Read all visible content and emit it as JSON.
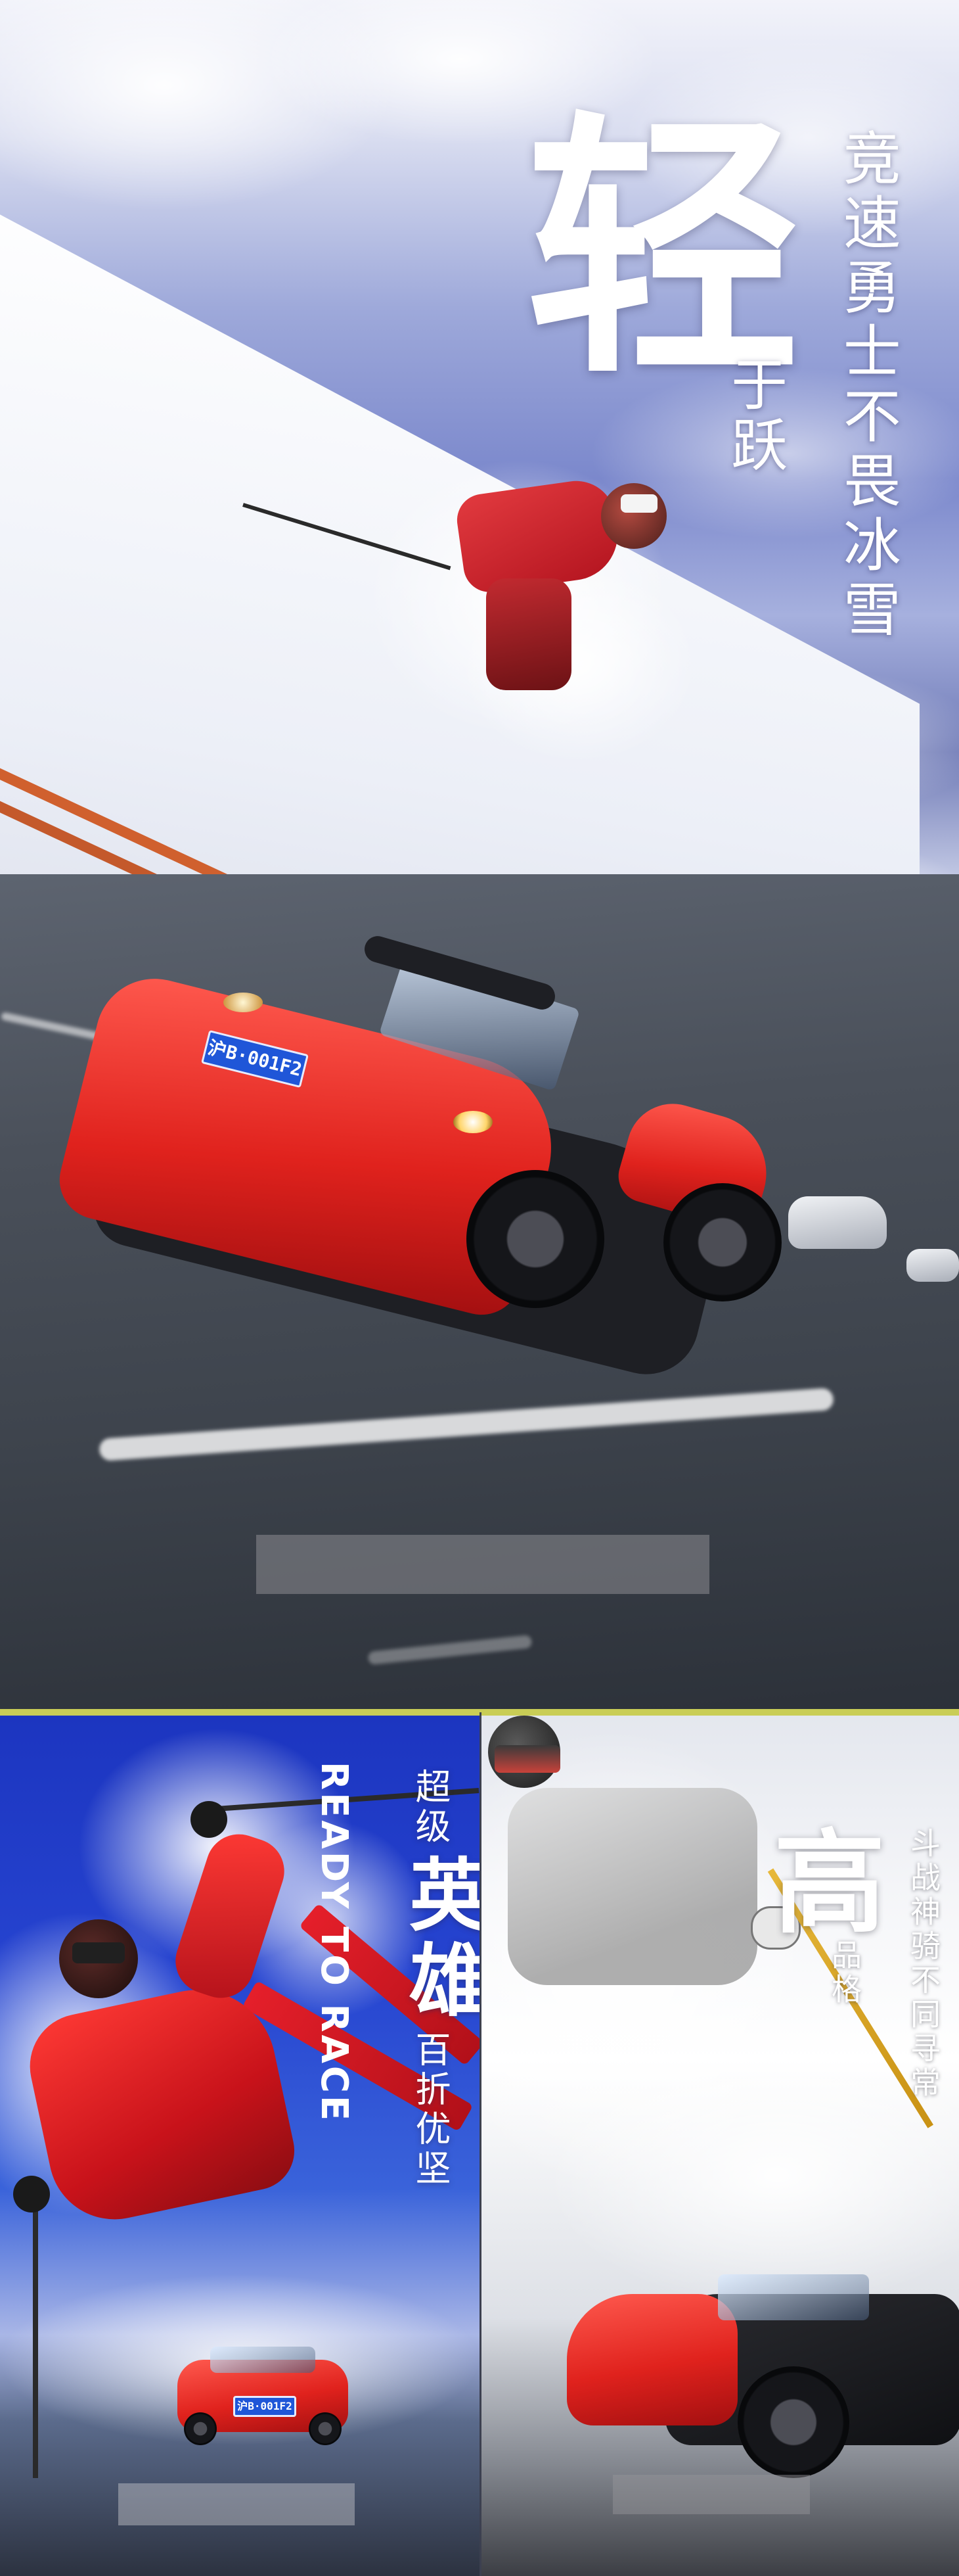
{
  "top_poster": {
    "big_char": "轻",
    "sub_char": "于跃",
    "tagline": "竞速勇士不畏冰雪",
    "plate": "沪B·001F2"
  },
  "left_poster": {
    "en_title": "READY TO RACE",
    "small_line": "超级",
    "big_char": "英雄",
    "tagline": "百折优坚",
    "plate": "沪B·001F2"
  },
  "right_poster": {
    "big_char": "高",
    "sub_char": "品格",
    "tagline": "斗战神骑不同寻常"
  },
  "colors": {
    "car_red": "#e0221d",
    "plate_blue": "#1f56d8",
    "sky_blue": "#7b88cc",
    "left_bg_blue": "#2644d0"
  }
}
